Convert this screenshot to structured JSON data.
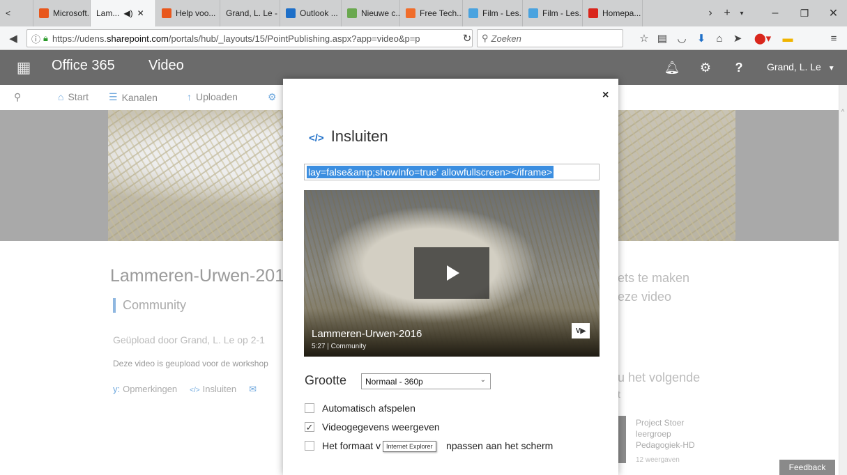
{
  "browser": {
    "tabs": [
      {
        "label": "Microsoft...",
        "color": "#e8571c"
      },
      {
        "label": "Lam...",
        "color": "#6b6b6b",
        "active": true
      },
      {
        "label": "Help voo...",
        "color": "#e8571c"
      },
      {
        "label": "Grand, L. Le - ...",
        "color": ""
      },
      {
        "label": "Outlook ...",
        "color": "#1e6fc8"
      },
      {
        "label": "Nieuwe c...",
        "color": "#6aa84f"
      },
      {
        "label": "Free Tech...",
        "color": "#f06d2b"
      },
      {
        "label": "Film - Les...",
        "color": "#4aa3df"
      },
      {
        "label": "Film - Les...",
        "color": "#4aa3df"
      },
      {
        "label": "Homepa...",
        "color": "#d9261c"
      }
    ],
    "url_prefix": "https://udens.",
    "url_host": "sharepoint.com",
    "url_rest": "/portals/hub/_layouts/15/PointPublishing.aspx?app=video&p=p",
    "search_placeholder": "Zoeken"
  },
  "suite": {
    "title": "Office 365",
    "app": "Video",
    "user": "Grand, L. Le"
  },
  "subnav": {
    "start": "Start",
    "channels": "Kanalen",
    "upload": "Uploaden"
  },
  "page": {
    "title": "Lammeren-Urwen-201",
    "channel": "Community",
    "uploaded_by": "Geüpload door Grand, L. Le op 2-1",
    "description": "Deze video is geupload voor de workshop",
    "comments": "Opmerkingen",
    "embed": "Insluiten",
    "right1": "ets te maken",
    "right2": "eze video",
    "right3": "u het volgende",
    "right4": "t",
    "related_title": "Project Stoer leergroep Pedagogiek-HD",
    "related_views": "12 weergaven",
    "feedback": "Feedback"
  },
  "modal": {
    "close": "×",
    "code_icon": "</>",
    "title": "Insluiten",
    "embed_code": "lay=false&amp;showInfo=true' allowfullscreen></iframe>",
    "video_title": "Lammeren-Urwen-2016",
    "video_duration": "5:27",
    "video_channel": "Community",
    "size_label": "Grootte",
    "size_value": "Normaal - 360p",
    "opt_autoplay": "Automatisch afspelen",
    "opt_showinfo": "Videogegevens weergeven",
    "opt_fit_a": "Het formaat v",
    "opt_fit_b": "npassen aan het scherm",
    "tooltip": "Internet Explorer",
    "checked": [
      false,
      true,
      false
    ]
  }
}
